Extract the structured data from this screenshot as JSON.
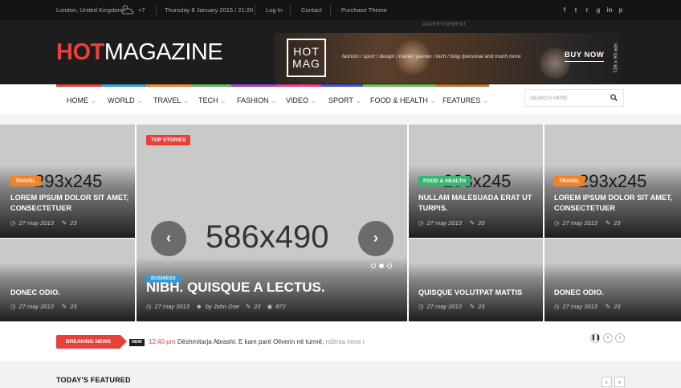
{
  "topbar": {
    "location": "London, United Kingdom",
    "temperature": "+7",
    "date": "Thursday 8 January 2015 / 21:20",
    "links": [
      "Log In",
      "Contact",
      "Purchase Theme"
    ],
    "social_icons": [
      "facebook-icon",
      "twitter-icon",
      "rss-icon",
      "google-plus-icon",
      "linkedin-icon",
      "pinterest-icon"
    ],
    "social_glyphs": [
      "f",
      "t",
      "r",
      "g",
      "in",
      "p"
    ]
  },
  "header": {
    "logo_hot": "HOT",
    "logo_magazine": "MAGAZINE",
    "ad_label": "ADVERTISEMENT",
    "banner": {
      "logo_line1": "HOT",
      "logo_line2": "MAG",
      "tagline": "fashion / sport / design / travel / games / tech / blog /personal and much more",
      "cta": "BUY NOW",
      "size": "728 x 90 ads"
    }
  },
  "nav": {
    "items": [
      {
        "label": "HOME"
      },
      {
        "label": "WORLD"
      },
      {
        "label": "TRAVEL"
      },
      {
        "label": "TECH"
      },
      {
        "label": "FASHION"
      },
      {
        "label": "VIDEO"
      },
      {
        "label": "SPORT"
      },
      {
        "label": "FOOD & HEALTH"
      },
      {
        "label": "FEATURES"
      }
    ],
    "colors": [
      "#e8403b",
      "#2d9de0",
      "#f08228",
      "#5cb85c",
      "#a43fd6",
      "#e83e8c",
      "#3f57d6",
      "#6cc04a",
      "#c8702a"
    ],
    "search_placeholder": "SEARCH HERE"
  },
  "grid": {
    "tiles": [
      {
        "placeholder": "293x245",
        "badge": "TRAVEL",
        "badge_color": "#f08228",
        "title": "LOREM IPSUM DOLOR SIT AMET, CONSECTETUER",
        "date": "27 may 2013",
        "comments": "23"
      },
      {
        "title": "DONEC ODIO.",
        "date": "27 may 2013",
        "comments": "23"
      },
      {
        "placeholder": "586x490",
        "badge": "TOP STORIES",
        "badge_color": "#e8403b",
        "badge2": "BUSINESS",
        "badge2_color": "#2d9de0",
        "title": "NIBH. QUISQUE A LECTUS.",
        "date": "27 may 2013",
        "author": "by John Doe",
        "comments": "23",
        "views": "872"
      },
      {
        "placeholder": "293x245",
        "badge": "FOOD & HEALTH",
        "badge_color": "#3cb371",
        "title": "NULLAM MALESUADA ERAT UT TURPIS.",
        "date": "27 may 2013",
        "comments": "20"
      },
      {
        "title": "QUISQUE VOLUTPAT MATTIS",
        "date": "27 may 2013",
        "comments": "23"
      },
      {
        "placeholder": "293x245",
        "badge": "TRAVEL",
        "badge_color": "#f08228",
        "title": "LOREM IPSUM DOLOR SIT AMET, CONSECTETUER",
        "date": "27 may 2013",
        "comments": "23"
      },
      {
        "title": "DONEC ODIO.",
        "date": "27 may 2013",
        "comments": "23"
      }
    ],
    "slider": {
      "dots": 3,
      "active_dot": 2
    }
  },
  "breaking": {
    "label": "BREAKING NEWS",
    "new_tag": "NEW",
    "time": "12:40 pm",
    "headline": "Dëshmitarja Abrashi: E kam parë Oliverin në turmë,",
    "headline_fade": " ndërsa neve r"
  },
  "featured": {
    "title": "TODAY'S FEATURED"
  }
}
